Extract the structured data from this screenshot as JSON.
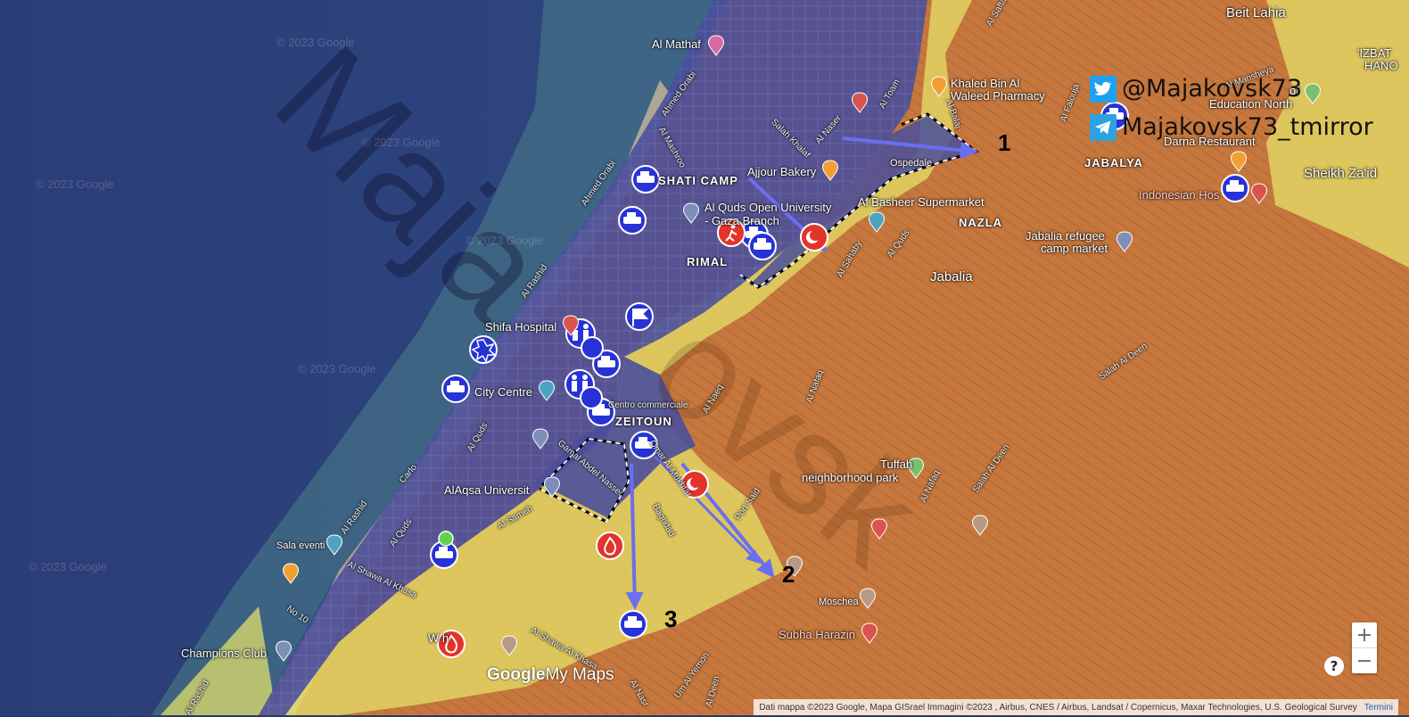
{
  "social": {
    "twitter_handle": "@Majakovsk73",
    "telegram_handle": "Majakovsk73_tmirror"
  },
  "watermark": {
    "copyright": "© 2023 Google"
  },
  "places": {
    "beit_lahia": "Beit Lahia",
    "izbat": "'IZBAT",
    "hano": "HANO",
    "al_mathaf": "Al Mathaf",
    "khaled_pharmacy_1": "Khaled Bin Al",
    "khaled_pharmacy_2": "Waleed Pharmacy",
    "education_north_1": "of",
    "education_north_2": "Education North",
    "darna_restaurant": "Darna Restaurant",
    "jabalya": "JABALYA",
    "sheikh_zaid": "Sheikh Za'id",
    "indonesian_hospital": "Indonesian Hos",
    "ospedale": "Ospedale",
    "shati_camp": "SHATI CAMP",
    "ajjour_bakery": "Ajjour Bakery",
    "al_quds_uni_1": "Al Quds Open University",
    "al_quds_uni_2": "- Gaza Branch",
    "al_basheer": "Al Basheer Supermarket",
    "nazla": "NAZLA",
    "jabalia_market_1": "Jabalia refugee",
    "jabalia_market_2": "camp market",
    "jabalia": "Jabalia",
    "rimal": "RIMAL",
    "shifa_hospital": "Shifa Hospital",
    "city_centre": "City Centre",
    "centro_commerciale": "Centro commerciale",
    "zeitoun": "ZEITOUN",
    "tuffah_park_1": "Tuffah",
    "tuffah_park_2": "neighborhood park",
    "alaqsa_university": "AlAqsa Universit",
    "sala_eventi": "Sala eventi",
    "moschea": "Moschea",
    "subha_harazin": "Subha Harazin",
    "champions_club": "Champions Club",
    "wahh": "W    h"
  },
  "streets": {
    "al_saftawi": "Al Saftawi",
    "ahmed_orabi": "Ahmed Orabi",
    "al_mashrooe": "Al Mashroo",
    "al_toam": "Al Toam",
    "salah_khalaf": "Salah Khalaf",
    "al_naser": "Al Naser",
    "al_balaj": "Al Balaj",
    "al_falouja": "Al Falouja",
    "al_mansheya": "Al Mansheya",
    "ahmed_orabi_2": "Ahmed Orabi",
    "al_rashid": "Al Rashid",
    "al_quds": "Al Quds",
    "al_sahaby": "Al Sahaby",
    "al_quds_2": "Al Quds",
    "salah_al_deen": "Salah Al Deen",
    "al_naeq": "Al Naeq",
    "al_nafaq": "Al Nafaq",
    "al_quds_3": "Al Quds",
    "carlo": "Carlo",
    "al_rashid_2": "Al Rashid",
    "al_quds_4": "Al Quds",
    "al_shawa_al_khasa": "Al Shawa Al Khasa",
    "no10": "No 10",
    "omar_al_mukhtar": "Omar Al Mukhtar",
    "jamal_abdel_nasser": "Gamal Abdel Nasser",
    "al_nafaq_2": "Al Nafaq",
    "al_sameh": "Al Sameh",
    "baghdad": "Baghdad",
    "port_said": "Port Said",
    "al_shawa_al_khasa_2": "Al Shawa Al Khasa",
    "um_al_yemon": "Um Al Yemon",
    "al_rashid_3": "Al Rashid",
    "al_nasr": "Al Nasr",
    "salah_al_deen_2": "Salah Al Deen",
    "al_deen": "Al Deen"
  },
  "arrow_labels": [
    "1",
    "2",
    "3"
  ],
  "branding": {
    "google": "Google",
    "mymaps": "My Maps"
  },
  "attribution": {
    "text": "Dati mappa ©2023 Google, Mapa GISrael Immagini ©2023 , Airbus, CNES / Airbus, Landsat / Copernicus, Maxar Technologies, U.S. Geological Survey",
    "terms": "Termini"
  },
  "controls": {
    "zoom_in": "+",
    "zoom_out": "−",
    "help": "?"
  },
  "colors": {
    "sea": "#263a6e",
    "israeli_control": "#4a4f9c",
    "contested": "#e6e46a",
    "hamas_control": "#c6773d",
    "marker_blue": "#2733d6",
    "marker_red": "#e2342b",
    "arrow": "#5b5fd8"
  }
}
